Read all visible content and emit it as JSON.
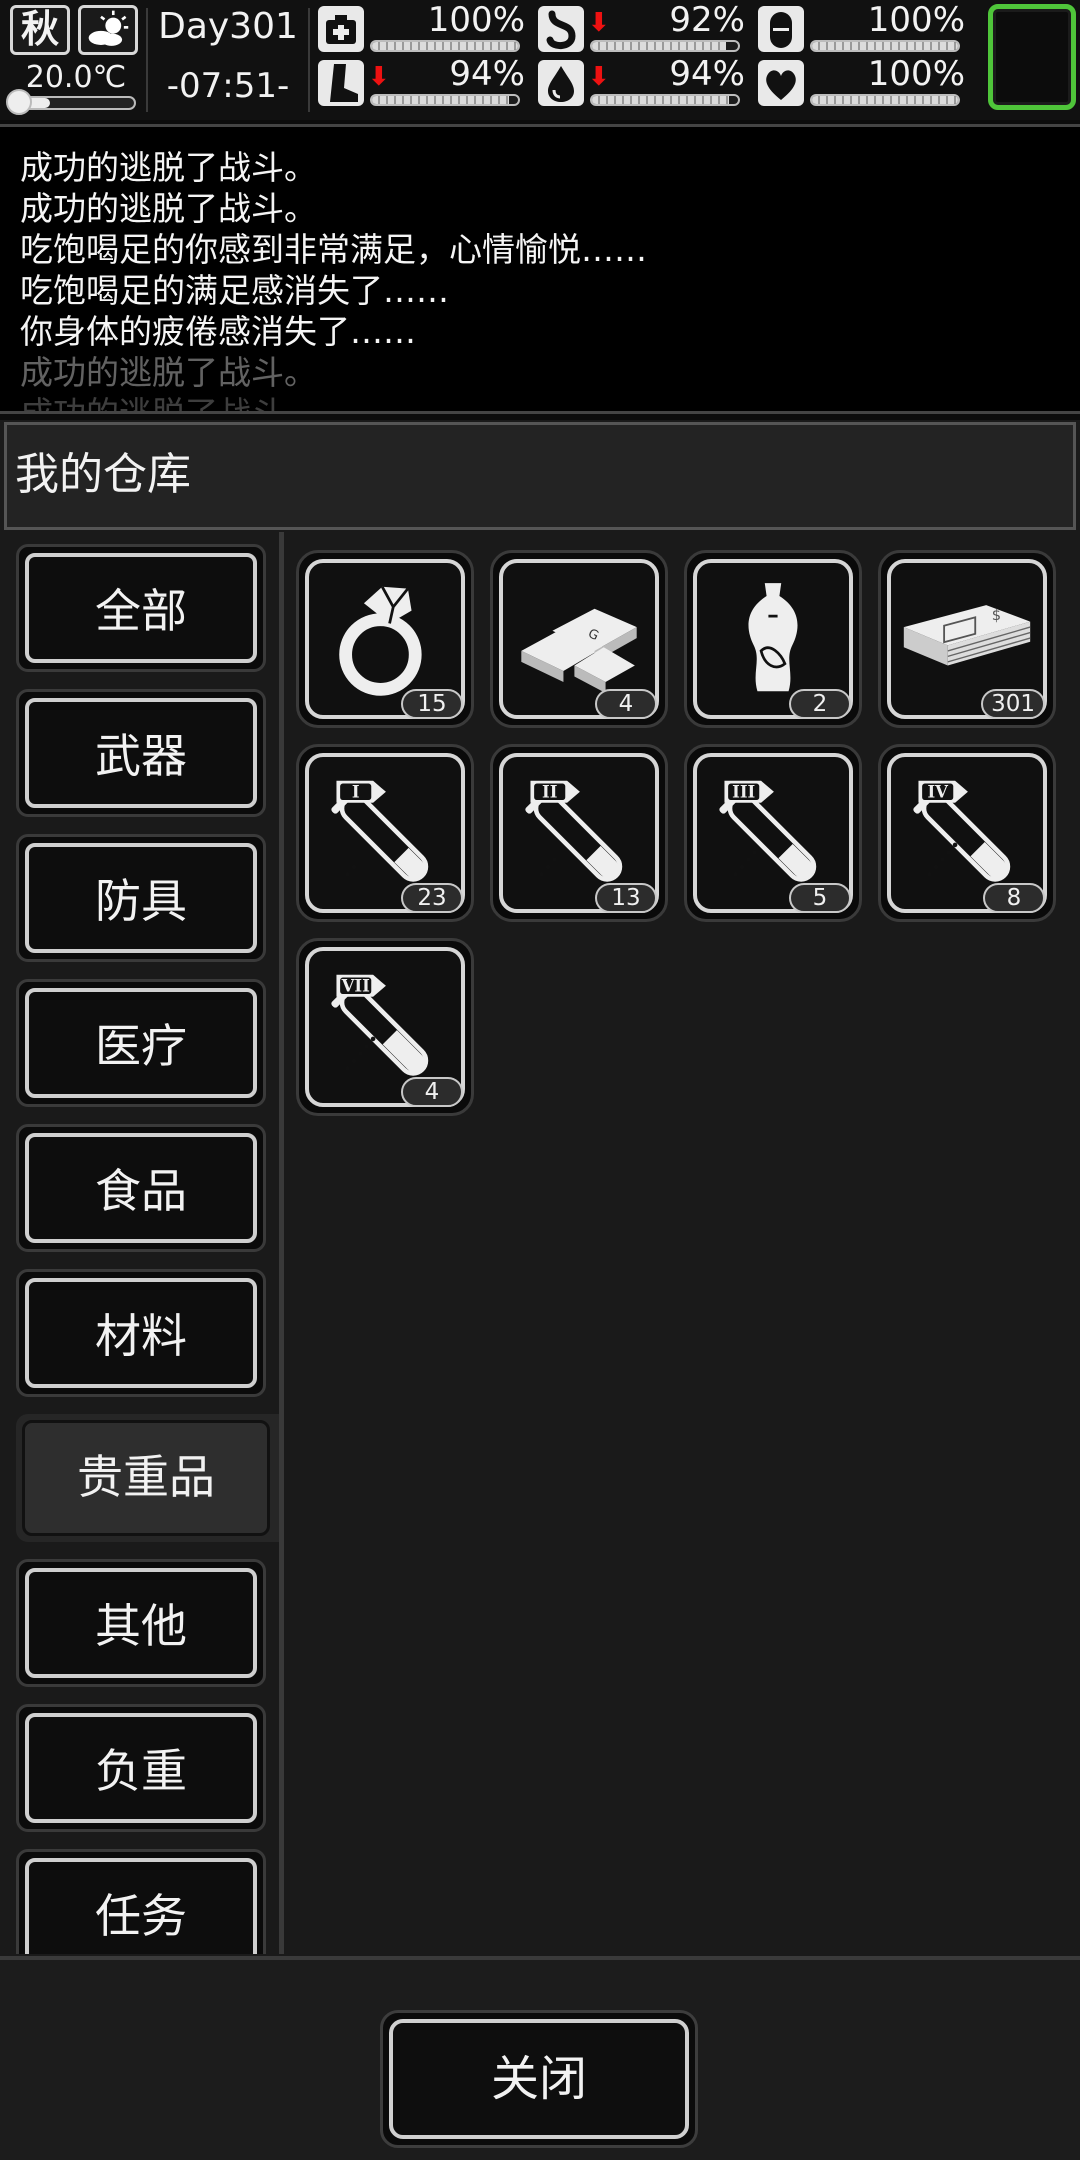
{
  "status": {
    "season": "秋",
    "temperature": "20.0℃",
    "day": "Day301",
    "time": "-07:51-",
    "stats": [
      {
        "name": "health",
        "icon": "medkit-icon",
        "value": "100%",
        "fill": 1.0,
        "decreasing": false
      },
      {
        "name": "hunger",
        "icon": "stomach-icon",
        "value": "92%",
        "fill": 0.92,
        "decreasing": true
      },
      {
        "name": "medicine",
        "icon": "pill-icon",
        "value": "100%",
        "fill": 1.0,
        "decreasing": false
      },
      {
        "name": "stamina",
        "icon": "leg-icon",
        "value": "94%",
        "fill": 0.94,
        "decreasing": true
      },
      {
        "name": "thirst",
        "icon": "water-drop-icon",
        "value": "94%",
        "fill": 0.94,
        "decreasing": true
      },
      {
        "name": "mood",
        "icon": "heart-icon",
        "value": "100%",
        "fill": 1.0,
        "decreasing": false
      }
    ],
    "temperature_level": 0.3
  },
  "log": [
    {
      "text": "成功的逃脱了战斗。",
      "opacity": 1
    },
    {
      "text": "成功的逃脱了战斗。",
      "opacity": 1
    },
    {
      "text": "吃饱喝足的你感到非常满足，心情愉悦……",
      "opacity": 1
    },
    {
      "text": "吃饱喝足的满足感消失了……",
      "opacity": 1
    },
    {
      "text": "你身体的疲倦感消失了……",
      "opacity": 1
    },
    {
      "text": "成功的逃脱了战斗。",
      "opacity": 0.4
    },
    {
      "text": "成功的逃脱了战斗。",
      "opacity": 0.25
    }
  ],
  "panel": {
    "title": "我的仓库",
    "categories": [
      "全部",
      "武器",
      "防具",
      "医疗",
      "食品",
      "材料",
      "贵重品",
      "其他",
      "负重",
      "任务"
    ],
    "active_category": 6,
    "items": [
      {
        "icon": "diamond-ring-icon",
        "count": "15"
      },
      {
        "icon": "gold-bars-icon",
        "count": "4"
      },
      {
        "icon": "porcelain-vase-icon",
        "count": "2"
      },
      {
        "icon": "cash-stack-icon",
        "count": "301"
      },
      {
        "icon": "test-tube-icon",
        "roman": "I",
        "count": "23"
      },
      {
        "icon": "test-tube-icon",
        "roman": "II",
        "count": "13"
      },
      {
        "icon": "test-tube-icon",
        "roman": "III",
        "count": "5"
      },
      {
        "icon": "test-tube-icon",
        "roman": "IV",
        "count": "8"
      },
      {
        "icon": "test-tube-icon",
        "roman": "VII",
        "count": "4"
      }
    ],
    "close_label": "关闭"
  },
  "colors": {
    "slot_border": "#4fc53a",
    "arrow": "#ee1111"
  }
}
